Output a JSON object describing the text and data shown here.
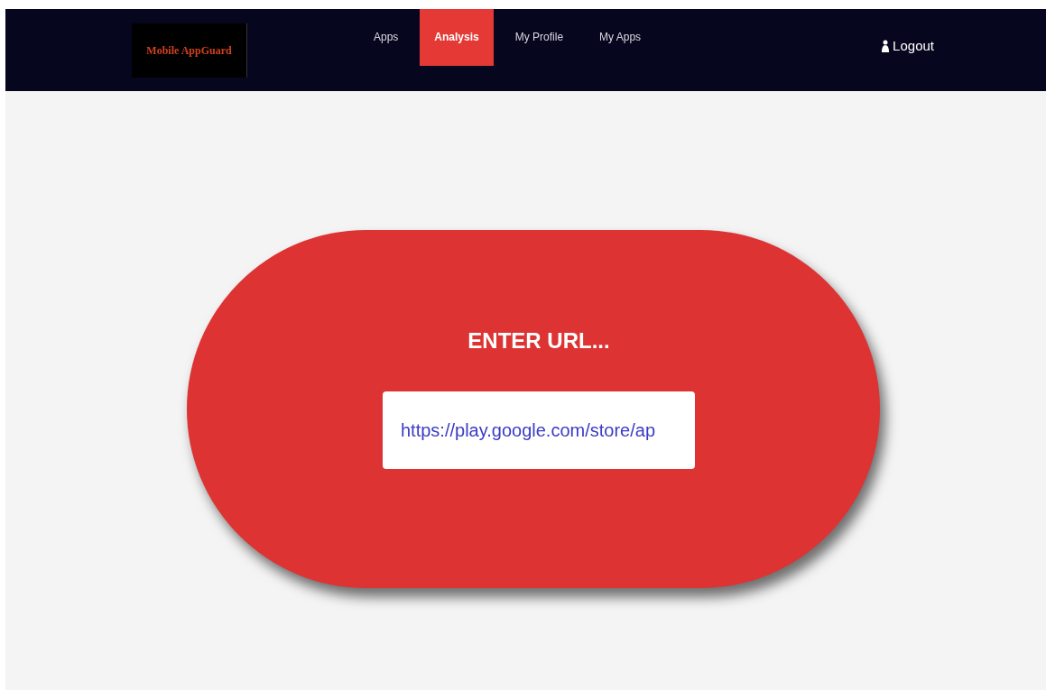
{
  "header": {
    "logo": "Mobile AppGuard",
    "nav": [
      {
        "label": "Apps",
        "selected": false
      },
      {
        "label": "Analysis",
        "selected": true
      },
      {
        "label": "My Profile",
        "selected": false
      },
      {
        "label": "My Apps",
        "selected": false
      }
    ],
    "logout": "Logout"
  },
  "form": {
    "heading": "ENTER URL...",
    "url_value": "https://play.google.com/store/ap"
  }
}
